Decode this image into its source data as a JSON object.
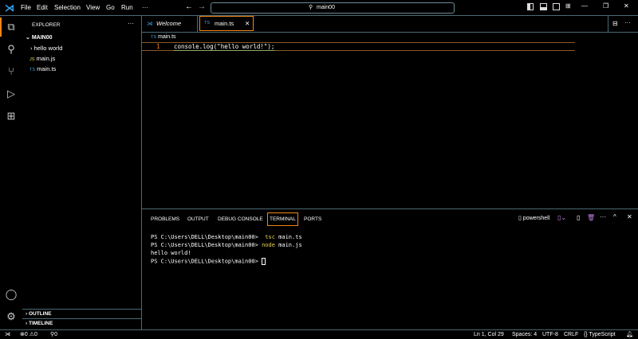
{
  "menu": [
    "File",
    "Edit",
    "Selection",
    "View",
    "Go",
    "Run",
    "···"
  ],
  "search": "main00",
  "sidebar": {
    "title": "EXPLORER",
    "more": "···",
    "root": "MAIN00",
    "items": [
      {
        "icon": "›",
        "label": "hello world"
      },
      {
        "icon": "JS",
        "label": "main.js"
      },
      {
        "icon": "TS",
        "label": "main.ts"
      }
    ],
    "outline": "OUTLINE",
    "timeline": "TIMELINE"
  },
  "tabs": [
    {
      "label": "Welcome"
    },
    {
      "icon": "TS",
      "label": "main.ts",
      "close": "✕"
    }
  ],
  "breadcrumb": {
    "icon": "TS",
    "label": "main.ts"
  },
  "editor": {
    "line_no": "1",
    "code": "console.log(\"hello world!\");"
  },
  "panel": {
    "tabs": [
      "PROBLEMS",
      "OUTPUT",
      "DEBUG CONSOLE",
      "TERMINAL",
      "PORTS"
    ],
    "shell": "powershell",
    "lines": [
      {
        "prompt": "PS C:\\Users\\DELL\\Desktop\\main00> ",
        "cmd": " tsc",
        "args": " main.ts"
      },
      {
        "prompt": "PS C:\\Users\\DELL\\Desktop\\main00> ",
        "cmd": "node",
        "args": " main.js"
      },
      {
        "prompt": "hello world!",
        "cmd": "",
        "args": ""
      },
      {
        "prompt": "PS C:\\Users\\DELL\\Desktop\\main00> ",
        "cmd": "",
        "args": ""
      }
    ]
  },
  "status": {
    "errors": "0",
    "warnings": "0",
    "ports": "0",
    "position": "Ln 1, Col 29",
    "spaces": "Spaces: 4",
    "encoding": "UTF-8",
    "eol": "CRLF",
    "language": "TypeScript"
  }
}
